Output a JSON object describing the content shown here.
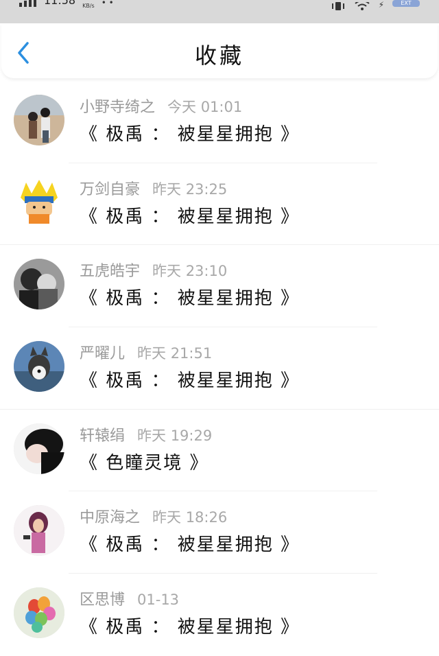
{
  "status_bar": {
    "time": "11:58",
    "speed_unit": "KB/s",
    "battery_label": "EXT"
  },
  "header": {
    "title": "收藏",
    "back_icon": "chevron-left-icon",
    "accent": "#2b8fe0"
  },
  "favorites": [
    {
      "user": "小野寺绮之",
      "time": "今天 01:01",
      "title": "《 极禹 ： 被星星拥抱 》",
      "avatar": "couple-photo"
    },
    {
      "user": "万剑自豪",
      "time": "昨天 23:25",
      "title": "《 极禹 ： 被星星拥抱 》",
      "avatar": "naruto-cartoon"
    },
    {
      "user": "五虎皓宇",
      "time": "昨天 23:10",
      "title": "《 极禹 ： 被星星拥抱 》",
      "avatar": "bw-couple-photo"
    },
    {
      "user": "严曜儿",
      "time": "昨天 21:51",
      "title": "《 极禹 ： 被星星拥抱 》",
      "avatar": "husky-dog-photo"
    },
    {
      "user": "轩辕绢",
      "time": "昨天 19:29",
      "title": "《 色瞳灵境 》",
      "avatar": "boy-portrait"
    },
    {
      "user": "中原海之",
      "time": "昨天 18:26",
      "title": "《 极禹 ： 被星星拥抱 》",
      "avatar": "girl-phone-photo"
    },
    {
      "user": "区思博",
      "time": "01-13",
      "title": "《 极禹 ： 被星星拥抱 》",
      "avatar": "colorful-balloons"
    }
  ]
}
